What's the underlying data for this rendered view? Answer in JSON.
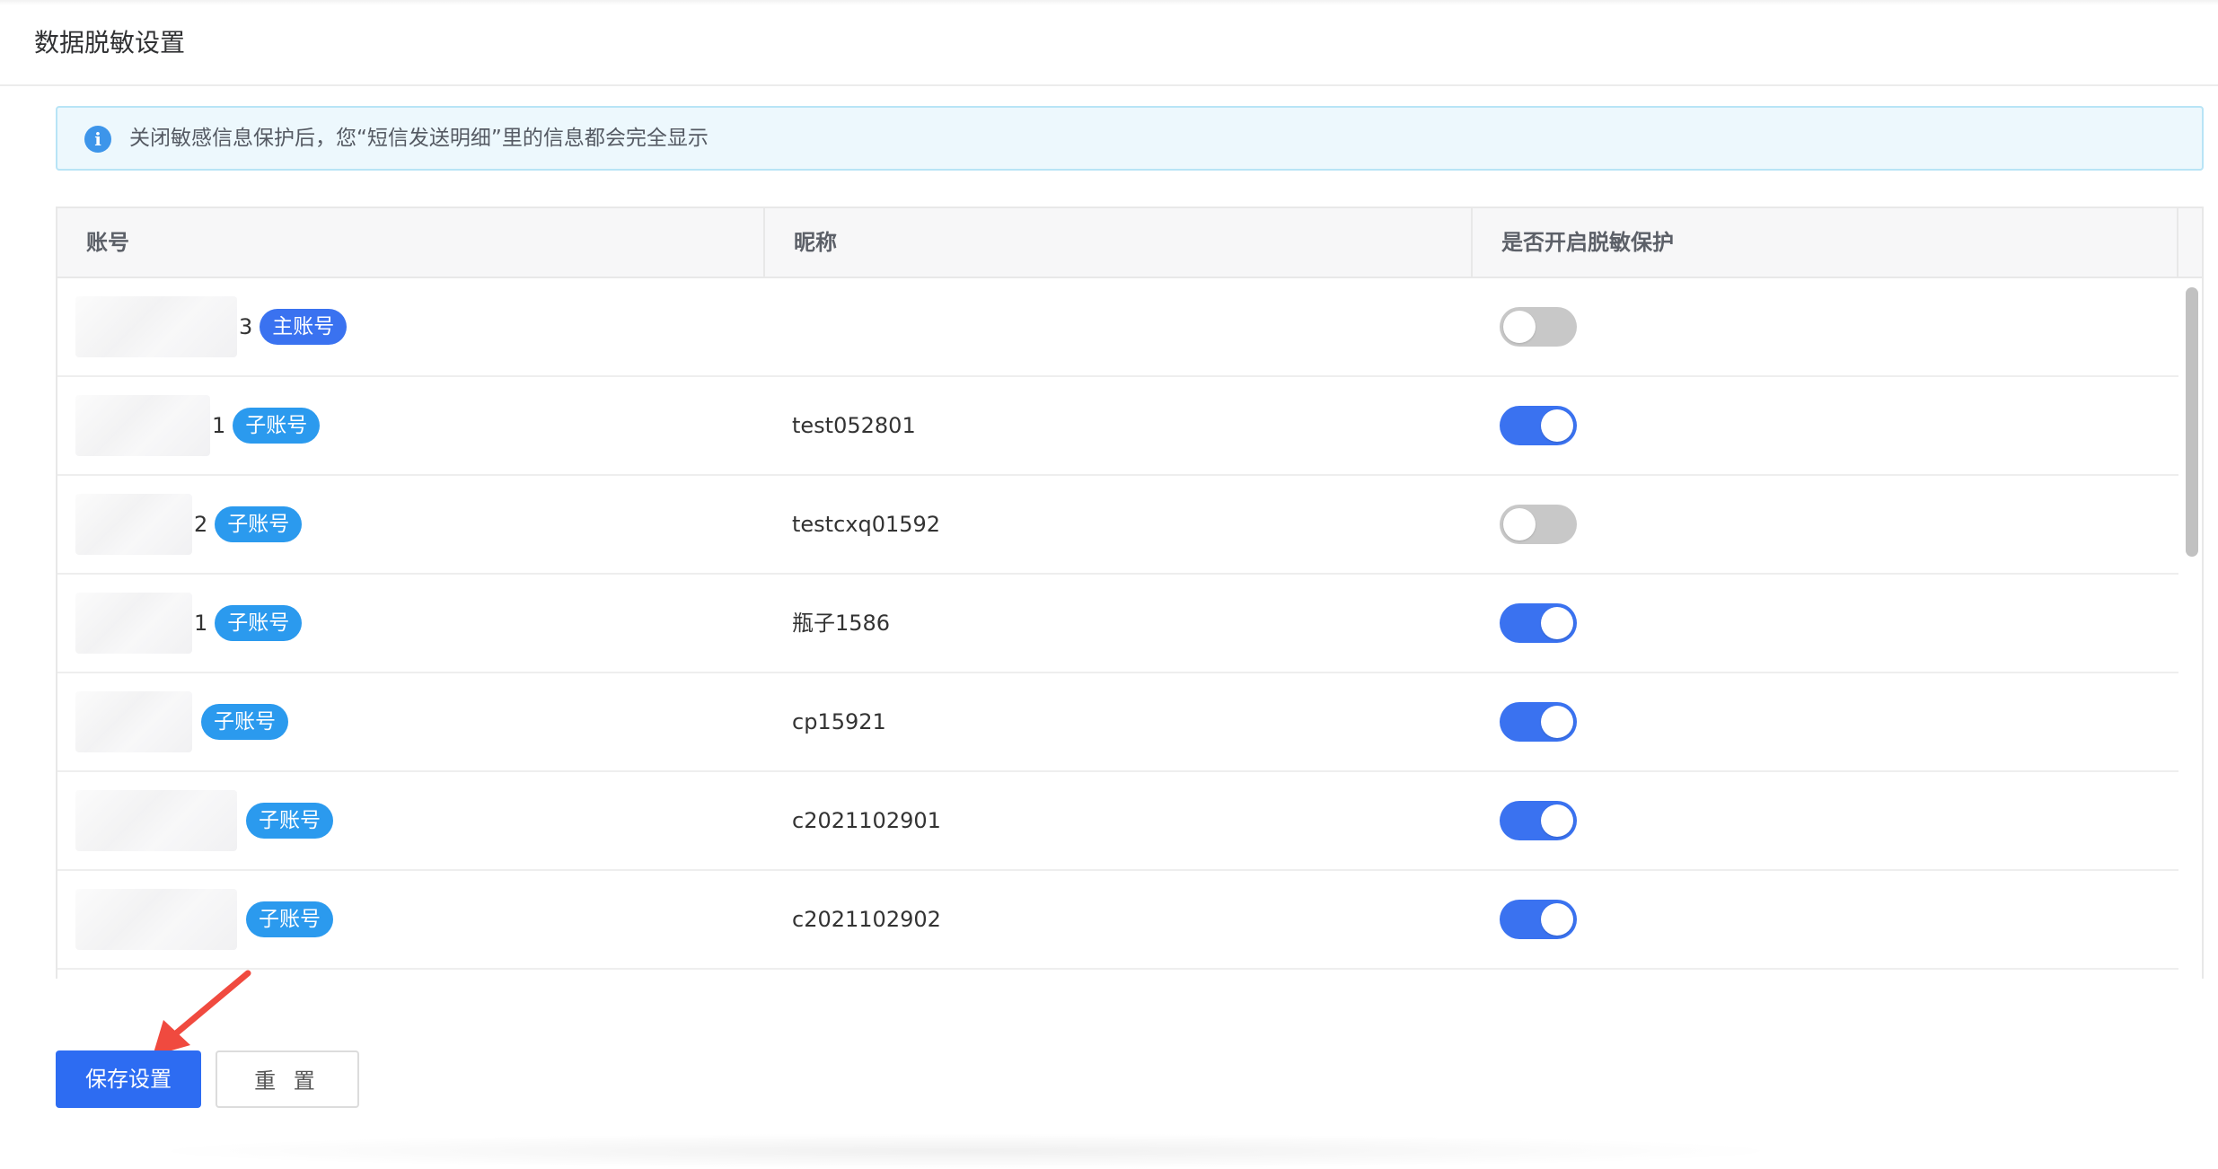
{
  "page": {
    "title": "数据脱敏设置"
  },
  "alert": {
    "icon": "info-icon",
    "icon_glyph": "i",
    "text": "关闭敏感信息保护后，您“短信发送明细”里的信息都会完全显示"
  },
  "table": {
    "columns": [
      "账号",
      "昵称",
      "是否开启脱敏保护"
    ],
    "rows": [
      {
        "account_tail": "3",
        "tag": "主账号",
        "tag_kind": "main",
        "nickname": "",
        "protected": false
      },
      {
        "account_tail": "1",
        "tag": "子账号",
        "tag_kind": "sub",
        "nickname": "test052801",
        "protected": true
      },
      {
        "account_tail": "2",
        "tag": "子账号",
        "tag_kind": "sub",
        "nickname": "testcxq01592",
        "protected": false
      },
      {
        "account_tail": "1",
        "tag": "子账号",
        "tag_kind": "sub",
        "nickname": "瓶子1586",
        "protected": true
      },
      {
        "account_tail": "",
        "tag": "子账号",
        "tag_kind": "sub",
        "nickname": "cp15921",
        "protected": true
      },
      {
        "account_tail": "",
        "tag": "子账号",
        "tag_kind": "sub",
        "nickname": "c2021102901",
        "protected": true
      },
      {
        "account_tail": "",
        "tag": "子账号",
        "tag_kind": "sub",
        "nickname": "c2021102902",
        "protected": true
      }
    ]
  },
  "actions": {
    "save_label": "保存设置",
    "reset_label": "重 置"
  },
  "colors": {
    "primary": "#2d6cf2",
    "tag_main": "#3a72f0",
    "tag_sub": "#2b9aee",
    "switch_off": "#c8c8c8",
    "alert_bg": "#edf8fd",
    "annotation_arrow": "#f04a3f"
  }
}
